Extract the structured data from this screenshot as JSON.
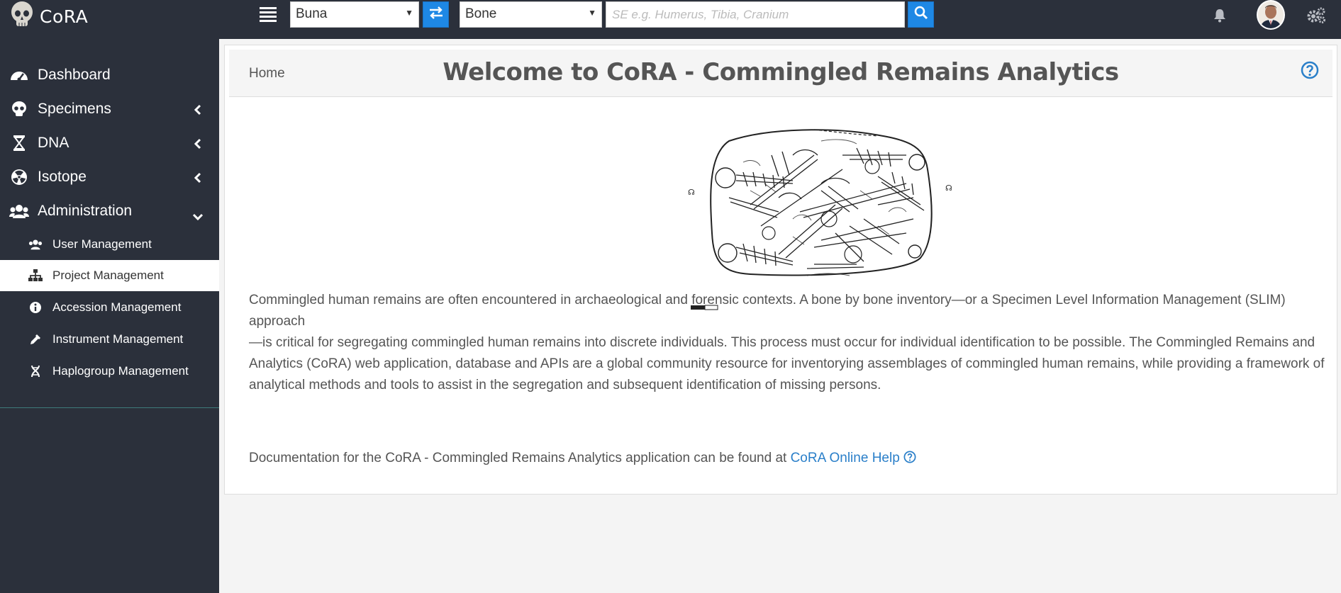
{
  "app": {
    "name": "CoRA"
  },
  "topbar": {
    "project_select": "Buna",
    "type_select": "Bone",
    "search_placeholder": "SE e.g. Humerus, Tibia, Cranium",
    "icons": [
      "skull-logo",
      "bars-icon",
      "swap-icon",
      "search-icon",
      "bell-icon",
      "avatar",
      "gears-icon"
    ]
  },
  "sidebar": {
    "items": [
      {
        "label": "Dashboard",
        "icon": "tachometer-icon"
      },
      {
        "label": "Specimens",
        "icon": "skull-icon"
      },
      {
        "label": "DNA",
        "icon": "hourglass-icon"
      },
      {
        "label": "Isotope",
        "icon": "radiation-icon"
      },
      {
        "label": "Administration",
        "icon": "users-icon"
      }
    ],
    "sub_items": [
      {
        "label": "User Management",
        "icon": "users-icon"
      },
      {
        "label": "Project Management",
        "icon": "sitemap-icon"
      },
      {
        "label": "Accession Management",
        "icon": "info-circle-icon"
      },
      {
        "label": "Instrument Management",
        "icon": "eyedropper-icon"
      },
      {
        "label": "Haplogroup Management",
        "icon": "dna-icon"
      }
    ]
  },
  "main": {
    "breadcrumb": "Home",
    "title": "Welcome to CoRA - Commingled Remains Analytics",
    "lines": [
      "Commingled human remains are often encountered in archaeological and forensic contexts. A bone by bone inventory—or a Specimen Level Information Management (SLIM) approach",
      "—is critical for segregating commingled human remains into discrete individuals. This process must occur for individual identification to be possible. The Commingled Remains and",
      "Analytics (CoRA) web application, database and APIs are a global community resource for inventorying assemblages of commingled human remains, while providing a framework of",
      "analytical methods and tools to assist in the segregation and subsequent identification of missing persons."
    ],
    "doc_text": "Documentation for the CoRA - Commingled Remains Analytics application can be found at",
    "doc_link": "CoRA Online Help"
  }
}
